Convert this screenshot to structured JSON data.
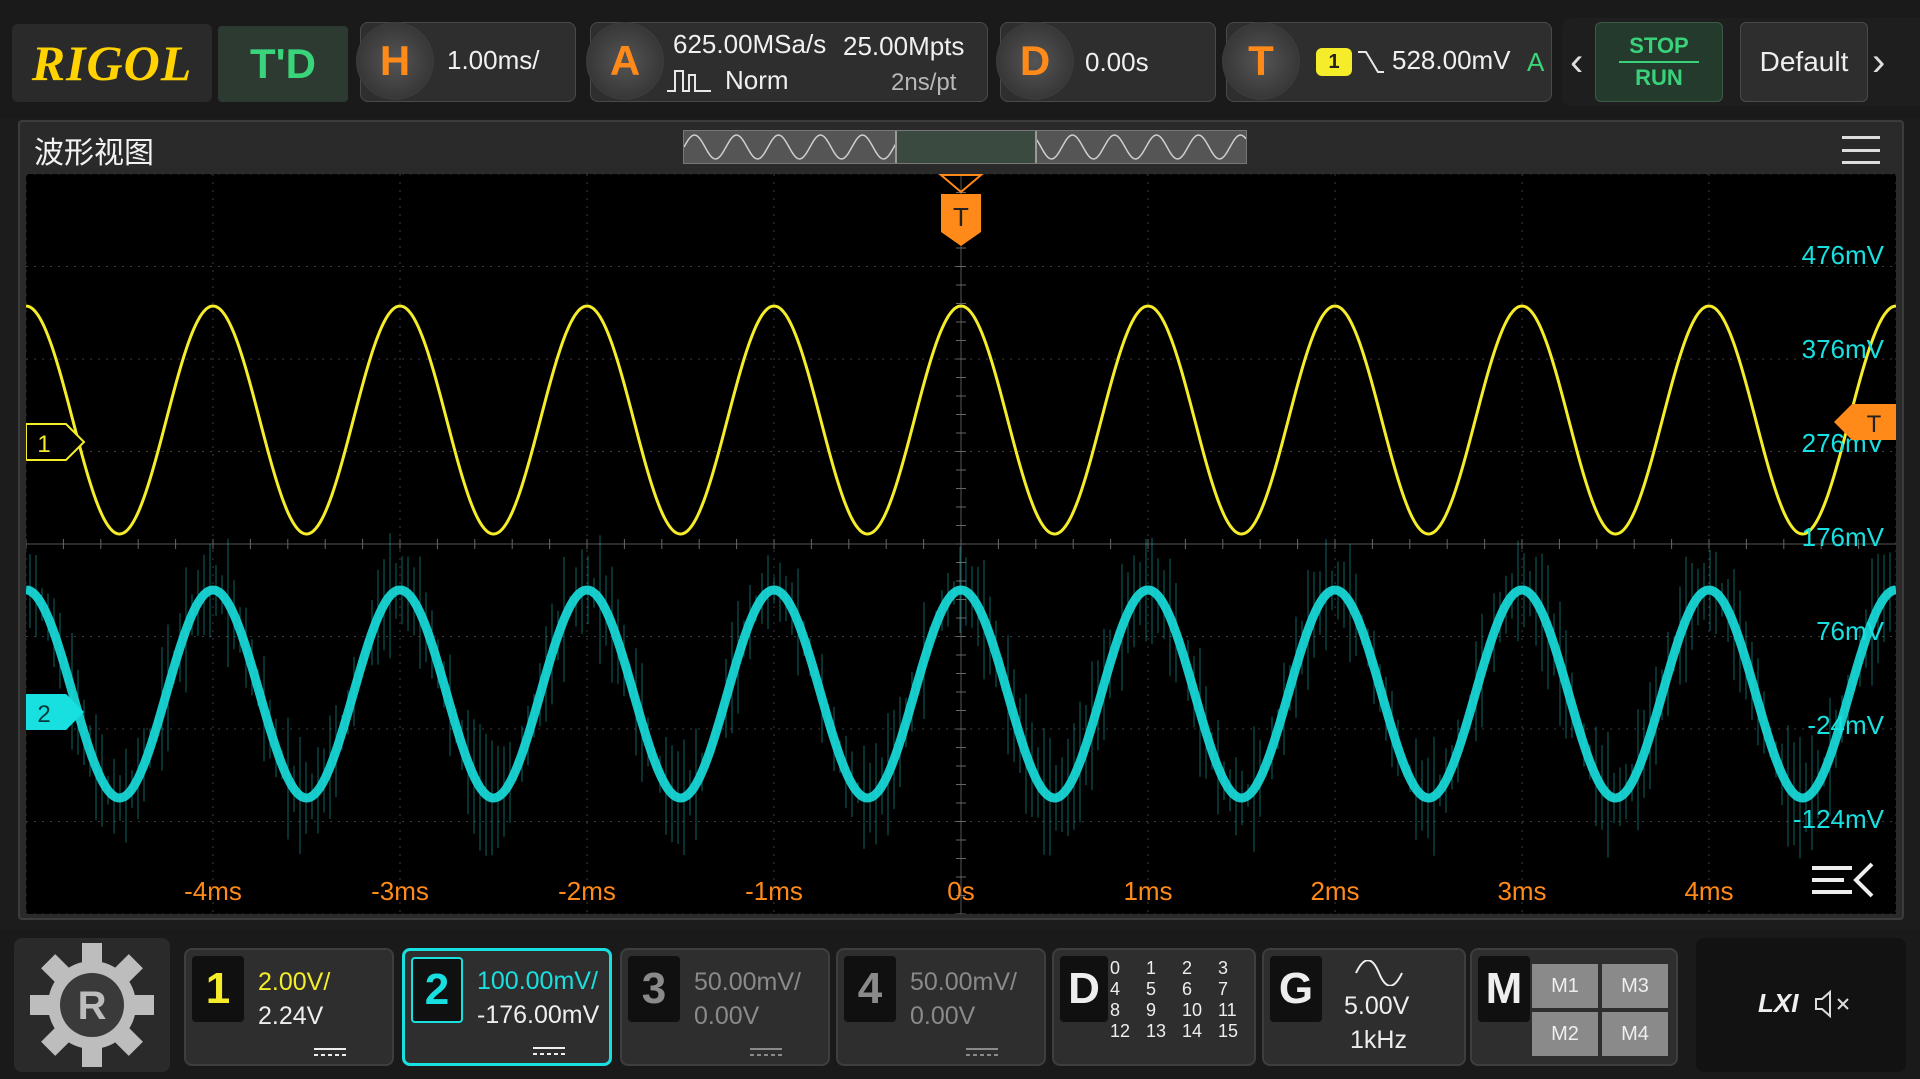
{
  "topbar": {
    "logo": "RIGOL",
    "mode": "T'D",
    "horizontal": {
      "key": "H",
      "scale": "1.00ms/"
    },
    "acquire": {
      "key": "A",
      "sample_rate": "625.00MSa/s",
      "memory_depth": "25.00Mpts",
      "mode": "Norm",
      "time_per_point": "2ns/pt"
    },
    "delay": {
      "key": "D",
      "value": "0.00s"
    },
    "trigger": {
      "key": "T",
      "source": "1",
      "level": "528.00mV",
      "sweep": "A"
    },
    "stop_label": "STOP",
    "run_label": "RUN",
    "default_label": "Default"
  },
  "window": {
    "title": "波形视图",
    "trigger_marker": "T",
    "ch1_marker": "1",
    "ch2_marker": "2",
    "trigger_level_marker": "T"
  },
  "right_labels": [
    "476mV",
    "376mV",
    "276mV",
    "176mV",
    "76mV",
    "-24mV",
    "-124mV"
  ],
  "time_labels": [
    "-4ms",
    "-3ms",
    "-2ms",
    "-1ms",
    "0s",
    "1ms",
    "2ms",
    "3ms",
    "4ms"
  ],
  "waveforms": {
    "ch1_color": "#f5ec2a",
    "ch2_color": "#19e0e0",
    "cycles_on_screen": 10
  },
  "channels": [
    {
      "num": "1",
      "scale": "2.00V/",
      "offset": "2.24V",
      "color": "#f5ec2a",
      "active": false,
      "enabled": true
    },
    {
      "num": "2",
      "scale": "100.00mV/",
      "offset": "-176.00mV",
      "color": "#19e0e0",
      "active": true,
      "enabled": true
    },
    {
      "num": "3",
      "scale": "50.00mV/",
      "offset": "0.00V",
      "color": "#8a8a8a",
      "active": false,
      "enabled": false
    },
    {
      "num": "4",
      "scale": "50.00mV/",
      "offset": "0.00V",
      "color": "#8a8a8a",
      "active": false,
      "enabled": false
    }
  ],
  "digital": {
    "key": "D",
    "channels": [
      "0",
      "1",
      "2",
      "3",
      "4",
      "5",
      "6",
      "7",
      "8",
      "9",
      "10",
      "11",
      "12",
      "13",
      "14",
      "15"
    ]
  },
  "generator": {
    "key": "G",
    "amplitude": "5.00V",
    "frequency": "1kHz"
  },
  "math": {
    "key": "M",
    "items": [
      "M1",
      "M3",
      "M2",
      "M4"
    ]
  },
  "status": {
    "lxi": "LXI"
  }
}
